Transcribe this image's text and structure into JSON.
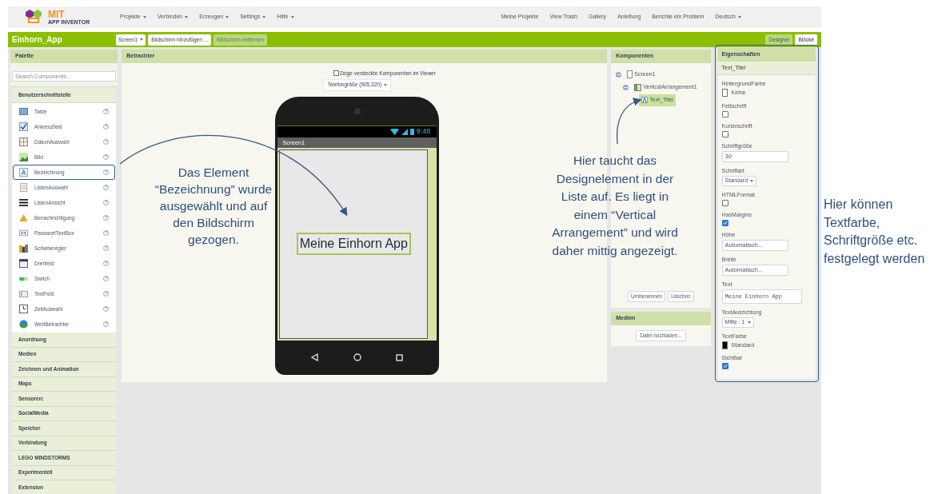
{
  "header": {
    "logo": {
      "title": "MIT",
      "subtitle": "APP INVENTOR"
    },
    "menus": [
      {
        "label": "Projekte",
        "dropdown": true
      },
      {
        "label": "Verbinden",
        "dropdown": true
      },
      {
        "label": "Erzeugen",
        "dropdown": true
      },
      {
        "label": "Settings",
        "dropdown": true
      },
      {
        "label": "Hilfe",
        "dropdown": true
      }
    ],
    "links": [
      {
        "label": "Meine Projekte",
        "dropdown": false
      },
      {
        "label": "View Trash",
        "dropdown": false
      },
      {
        "label": "Gallery",
        "dropdown": false
      },
      {
        "label": "Anleitung",
        "dropdown": false
      },
      {
        "label": "Berichte ein Problem",
        "dropdown": false
      },
      {
        "label": "Deutsch",
        "dropdown": true
      }
    ]
  },
  "project_bar": {
    "name": "Einhorn_App",
    "screen_select": "Screen1",
    "buttons": [
      {
        "label": "Bildschirm hinzufügen ...",
        "disabled": false
      },
      {
        "label": "Bildschirm entfernen",
        "disabled": true
      }
    ],
    "modes": [
      {
        "label": "Designer",
        "selected": true
      },
      {
        "label": "Blöcke",
        "selected": false
      }
    ]
  },
  "palette": {
    "title": "Palette",
    "search_placeholder": "Search Components...",
    "groups": [
      {
        "label": "Benutzerschnittstelle",
        "items": [
          {
            "label": "Taste",
            "kind": "button",
            "highlighted": false,
            "help": "?"
          },
          {
            "label": "Ankreuzfeld",
            "kind": "checkbox",
            "highlighted": false,
            "help": "?"
          },
          {
            "label": "DatumAuswahl",
            "kind": "datepicker",
            "highlighted": false,
            "help": "?"
          },
          {
            "label": "Bild",
            "kind": "image",
            "highlighted": false,
            "help": "?"
          },
          {
            "label": "Bezeichnung",
            "kind": "label",
            "highlighted": true,
            "help": "?"
          },
          {
            "label": "ListenAuswahl",
            "kind": "listpicker",
            "highlighted": false,
            "help": "?"
          },
          {
            "label": "ListenAnsicht",
            "kind": "listview",
            "highlighted": false,
            "help": "?"
          },
          {
            "label": "Benachrichtigung",
            "kind": "notifier",
            "highlighted": false,
            "help": "?"
          },
          {
            "label": "PasswortTextBox",
            "kind": "password",
            "highlighted": false,
            "help": "?"
          },
          {
            "label": "Schieberegler",
            "kind": "slider",
            "highlighted": false,
            "help": "?"
          },
          {
            "label": "Drehfeld",
            "kind": "spinner",
            "highlighted": false,
            "help": "?"
          },
          {
            "label": "Switch",
            "kind": "switch",
            "highlighted": false,
            "help": "?"
          },
          {
            "label": "TextFeld",
            "kind": "textbox",
            "highlighted": false,
            "help": "?"
          },
          {
            "label": "ZeitAuswahl",
            "kind": "timepicker",
            "highlighted": false,
            "help": "?"
          },
          {
            "label": "WebBetrachter",
            "kind": "webviewer",
            "highlighted": false,
            "help": "?"
          }
        ]
      },
      {
        "label": "Anordnung"
      },
      {
        "label": "Medien"
      },
      {
        "label": "Zeichnen und Animation"
      },
      {
        "label": "Maps"
      },
      {
        "label": "Sensoren:"
      },
      {
        "label": "SocialMedia"
      },
      {
        "label": "Speicher"
      },
      {
        "label": "Verbindung"
      },
      {
        "label": "LEGO MINDSTORMS"
      },
      {
        "label": "Experimentell"
      },
      {
        "label": "Extension"
      }
    ]
  },
  "viewer": {
    "title": "Betrachter",
    "hidden_checkbox": {
      "label": "Zeige versteckte Komponenten im Viewer",
      "checked": false
    },
    "size_select": "Telefongröße (505,320)",
    "phone": {
      "time": "9:48",
      "screen_title": "Screen1",
      "label_text": "Meine Einhorn App"
    }
  },
  "components": {
    "title": "Komponenten",
    "tree": [
      {
        "label": "Screen1",
        "kind": "screen",
        "expanded": true,
        "selected": false,
        "children": [
          {
            "label": "VerticalArrangement1",
            "kind": "arrangement",
            "expanded": true,
            "selected": false,
            "children": [
              {
                "label": "Text_Titel",
                "kind": "label",
                "selected": true
              }
            ]
          }
        ]
      }
    ],
    "buttons": [
      "Umbenennen",
      "Löschen"
    ]
  },
  "media": {
    "title": "Medien",
    "button": "Datei hochladen..."
  },
  "properties": {
    "title": "Eigenschaften",
    "component": "Text_Titel",
    "items": [
      {
        "label": "HintergrundFarbe",
        "kind": "color",
        "value": "Keine",
        "color": "#ffffff"
      },
      {
        "label": "Fettschrift",
        "kind": "checkbox",
        "checked": false
      },
      {
        "label": "Kursivschrift",
        "kind": "checkbox",
        "checked": false
      },
      {
        "label": "Schriftgröße",
        "kind": "input",
        "value": "30"
      },
      {
        "label": "Schriftart",
        "kind": "select",
        "value": "Standard"
      },
      {
        "label": "HTMLFormat",
        "kind": "checkbox",
        "checked": false
      },
      {
        "label": "HasMargins",
        "kind": "checkbox",
        "checked": true
      },
      {
        "label": "Höhe",
        "kind": "input",
        "value": "Automatisch..."
      },
      {
        "label": "Breite",
        "kind": "input",
        "value": "Automatisch..."
      },
      {
        "label": "Text",
        "kind": "textarea",
        "value": "Meine Einhorn App"
      },
      {
        "label": "TextAusrichtung",
        "kind": "select",
        "value": "Mitte : 1"
      },
      {
        "label": "TextFarbe",
        "kind": "color",
        "value": "Standard",
        "color": "#000000"
      },
      {
        "label": "Sichtbar",
        "kind": "checkbox",
        "checked": true
      }
    ]
  },
  "annotations": [
    {
      "text": "Das Element “Bezeichnung” wurde ausgewählt und auf den Bildschirm gezogen."
    },
    {
      "text": "Hier taucht das Designelement in der Liste auf. Es liegt in einem “Vertical Arrangement” und wird daher mittig angezeigt."
    },
    {
      "text": "Hier können Textfarbe, Schriftgröße etc. festgelegt werden"
    }
  ]
}
